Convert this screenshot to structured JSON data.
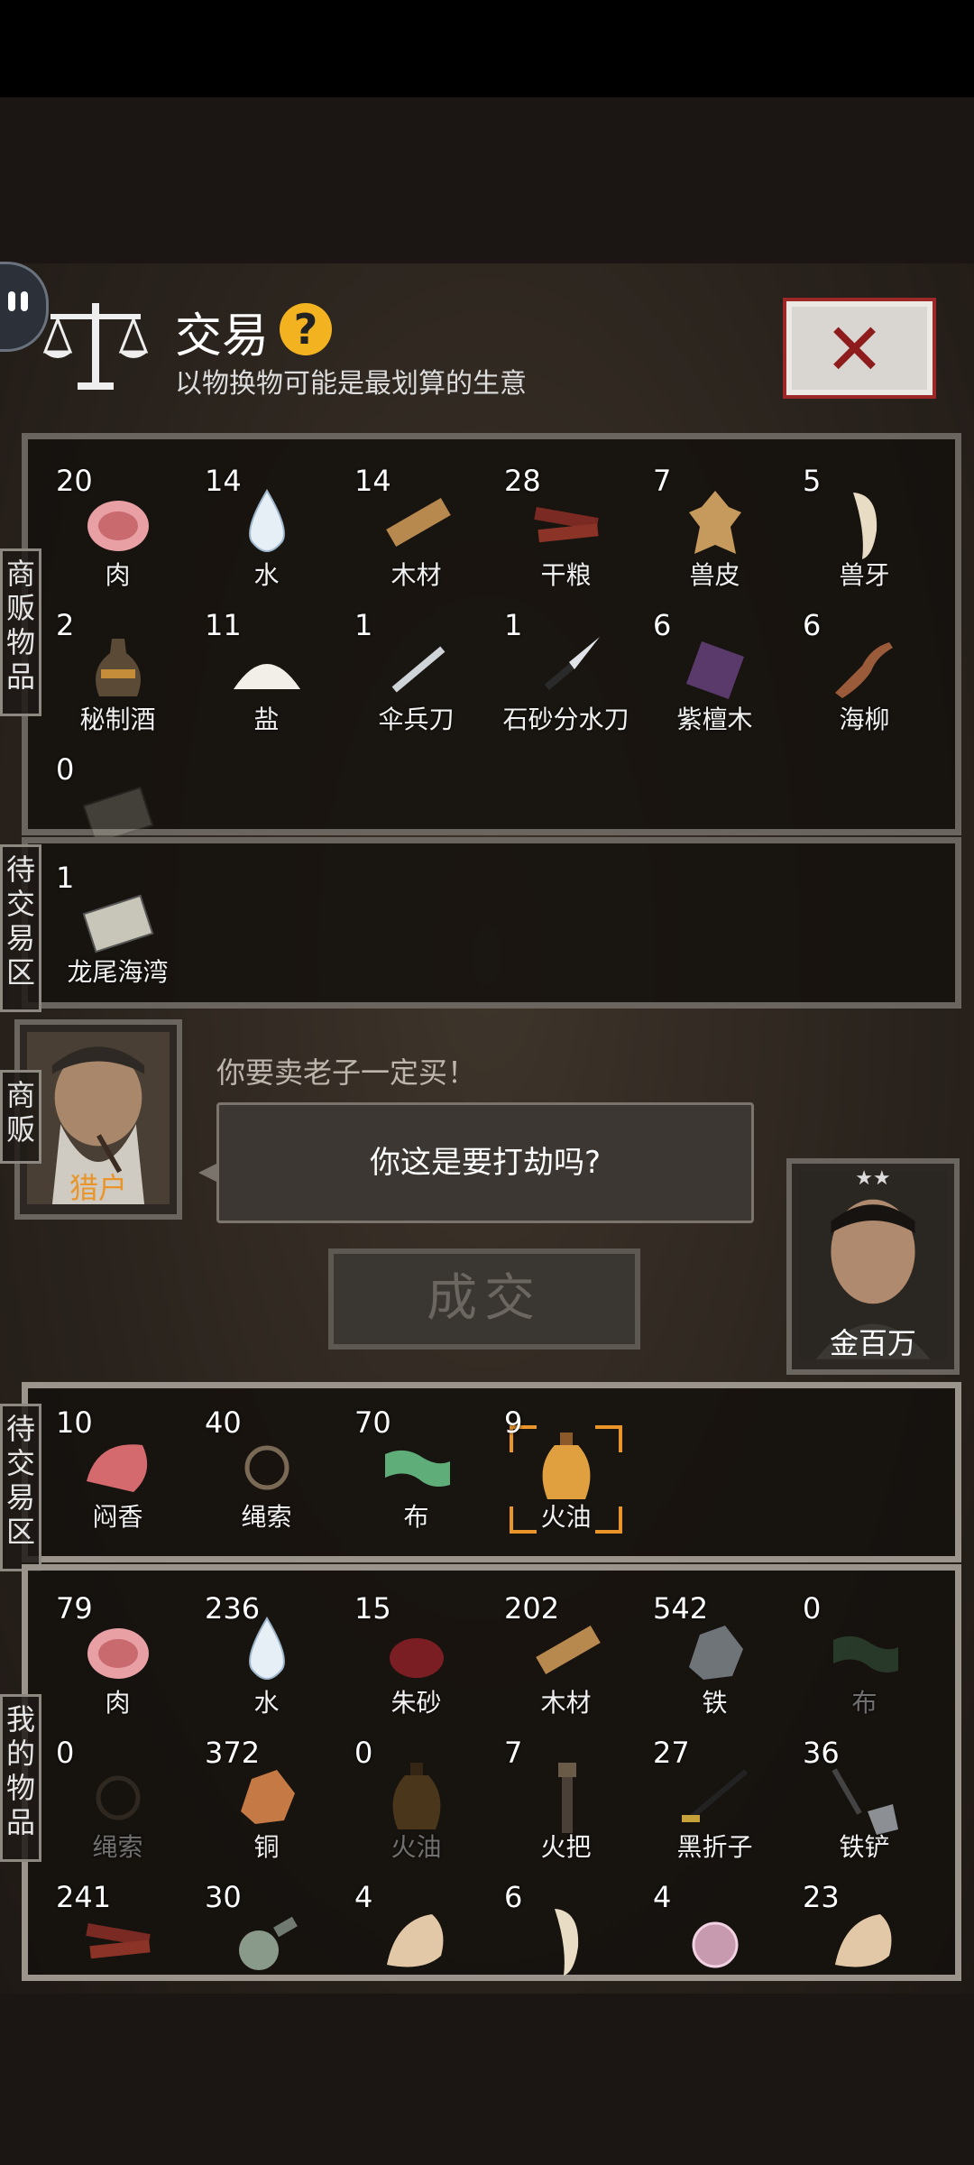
{
  "header": {
    "title": "交易",
    "help_symbol": "?",
    "subtitle": "以物换物可能是最划算的生意",
    "close_symbol": "✕"
  },
  "sections": {
    "vendor_items_label": "商贩物品",
    "pending_top_label": "待交易区",
    "vendor_label": "商贩",
    "pending_bottom_label": "待交易区",
    "my_items_label": "我的物品"
  },
  "vendor_items": [
    {
      "count": "20",
      "name": "肉",
      "icon": "meat-icon"
    },
    {
      "count": "14",
      "name": "水",
      "icon": "water-drop-icon"
    },
    {
      "count": "14",
      "name": "木材",
      "icon": "wood-plank-icon"
    },
    {
      "count": "28",
      "name": "干粮",
      "icon": "jerky-icon"
    },
    {
      "count": "7",
      "name": "兽皮",
      "icon": "animal-hide-icon"
    },
    {
      "count": "5",
      "name": "兽牙",
      "icon": "fang-icon"
    },
    {
      "count": "2",
      "name": "秘制酒",
      "icon": "liquor-jar-icon"
    },
    {
      "count": "11",
      "name": "盐",
      "icon": "salt-pile-icon"
    },
    {
      "count": "1",
      "name": "伞兵刀",
      "icon": "paratrooper-knife-icon"
    },
    {
      "count": "1",
      "name": "石砂分水刀",
      "icon": "knife-icon"
    },
    {
      "count": "6",
      "name": "紫檀木",
      "icon": "rosewood-icon"
    },
    {
      "count": "6",
      "name": "海柳",
      "icon": "driftwood-icon"
    },
    {
      "count": "0",
      "name": "",
      "icon": "map-icon"
    }
  ],
  "vendor_pending": [
    {
      "count": "1",
      "name": "龙尾海湾",
      "icon": "map-icon"
    }
  ],
  "vendor": {
    "name": "猎户",
    "quote": "你要卖老子一定买！",
    "bubble": "你这是要打劫吗?"
  },
  "player": {
    "name": "金百万",
    "stars": "★★"
  },
  "deal_label": "成交",
  "my_pending": [
    {
      "count": "10",
      "name": "闷香",
      "icon": "meat-chunk-icon"
    },
    {
      "count": "40",
      "name": "绳索",
      "icon": "rope-icon"
    },
    {
      "count": "70",
      "name": "布",
      "icon": "cloth-icon"
    },
    {
      "count": "9",
      "name": "火油",
      "icon": "oil-bottle-icon"
    }
  ],
  "my_items": [
    {
      "count": "79",
      "name": "肉",
      "icon": "meat-icon"
    },
    {
      "count": "236",
      "name": "水",
      "icon": "water-drop-icon"
    },
    {
      "count": "15",
      "name": "朱砂",
      "icon": "cinnabar-icon"
    },
    {
      "count": "202",
      "name": "木材",
      "icon": "wood-plank-icon"
    },
    {
      "count": "542",
      "name": "铁",
      "icon": "iron-ore-icon"
    },
    {
      "count": "0",
      "name": "布",
      "icon": "cloth-icon"
    },
    {
      "count": "0",
      "name": "绳索",
      "icon": "rope-icon"
    },
    {
      "count": "372",
      "name": "铜",
      "icon": "copper-ore-icon"
    },
    {
      "count": "0",
      "name": "火油",
      "icon": "oil-bottle-icon"
    },
    {
      "count": "7",
      "name": "火把",
      "icon": "torch-icon"
    },
    {
      "count": "27",
      "name": "黑折子",
      "icon": "fire-starter-icon"
    },
    {
      "count": "36",
      "name": "铁铲",
      "icon": "shovel-icon"
    },
    {
      "count": "241",
      "name": "",
      "icon": "jerky-icon"
    },
    {
      "count": "30",
      "name": "",
      "icon": "gourd-icon"
    },
    {
      "count": "4",
      "name": "",
      "icon": "claw-icon"
    },
    {
      "count": "6",
      "name": "",
      "icon": "fang-icon"
    },
    {
      "count": "4",
      "name": "",
      "icon": "pearl-icon"
    },
    {
      "count": "23",
      "name": "",
      "icon": "claw-icon"
    }
  ]
}
